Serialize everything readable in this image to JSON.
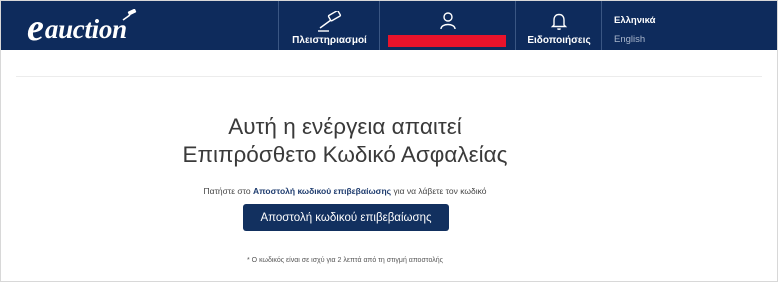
{
  "header": {
    "logo": "eauction",
    "nav": {
      "auctions_label": "Πλειστηριασμοί",
      "account_label": "",
      "notifications_label": "Ειδοποιήσεις"
    },
    "languages": {
      "greek": "Ελληνικά",
      "english": "English"
    }
  },
  "main": {
    "title_line1": "Αυτή η ενέργεια απαιτεί",
    "title_line2": "Επιπρόσθετο Κωδικό Ασφαλείας",
    "instruction_prefix": "Πατήστε στο",
    "instruction_link": "Αποστολή κωδικού επιβεβαίωσης",
    "instruction_suffix": "για να λάβετε τον κωδικό",
    "send_button_label": "Αποστολή κωδικού επιβεβαίωσης",
    "footnote": "* Ο κωδικός είναι σε ισχύ για 2 λεπτά από τη στιγμή αποστολής"
  },
  "colors": {
    "header_background": "#0e2b5c",
    "button_background": "#12305f",
    "redaction": "#e8132b"
  },
  "icons": {
    "auctions": "gavel-icon",
    "account": "user-icon",
    "notifications": "bell-icon"
  }
}
